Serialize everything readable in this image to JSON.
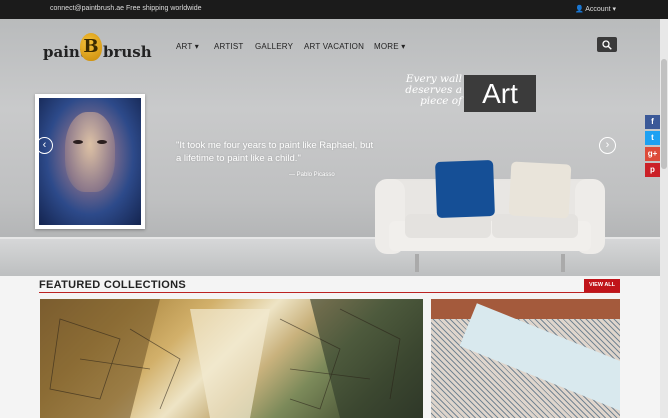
{
  "topbar": {
    "email": "connect@paintbrush.ae",
    "shipping": "Free shipping worldwide",
    "account": "Account ▾"
  },
  "logo": {
    "part1": "paint",
    "letter": "B",
    "part2": "brush"
  },
  "nav": {
    "items": [
      {
        "label": "ART ▾"
      },
      {
        "label": "ARTIST"
      },
      {
        "label": "GALLERY"
      },
      {
        "label": "ART VACATION"
      },
      {
        "label": "MORE ▾"
      }
    ]
  },
  "hero": {
    "quote": "\"It took me four years to paint like Raphael, but a lifetime to paint like a child.\"",
    "author": "— Pablo Picasso",
    "tagline": "Every wall deserves a piece of",
    "art_word": "Art",
    "prev": "‹",
    "next": "›"
  },
  "social": [
    {
      "icon": "facebook-icon",
      "glyph": "f",
      "color": "#3b5998"
    },
    {
      "icon": "twitter-icon",
      "glyph": "t",
      "color": "#1da1f2"
    },
    {
      "icon": "google-plus-icon",
      "glyph": "g+",
      "color": "#dd4b39"
    },
    {
      "icon": "pinterest-icon",
      "glyph": "p",
      "color": "#cb2027"
    }
  ],
  "featured": {
    "title": "FEATURED COLLECTIONS",
    "view_all": "VIEW ALL"
  },
  "colors": {
    "accent": "#c0141a",
    "topbar": "#1b1b1b"
  }
}
